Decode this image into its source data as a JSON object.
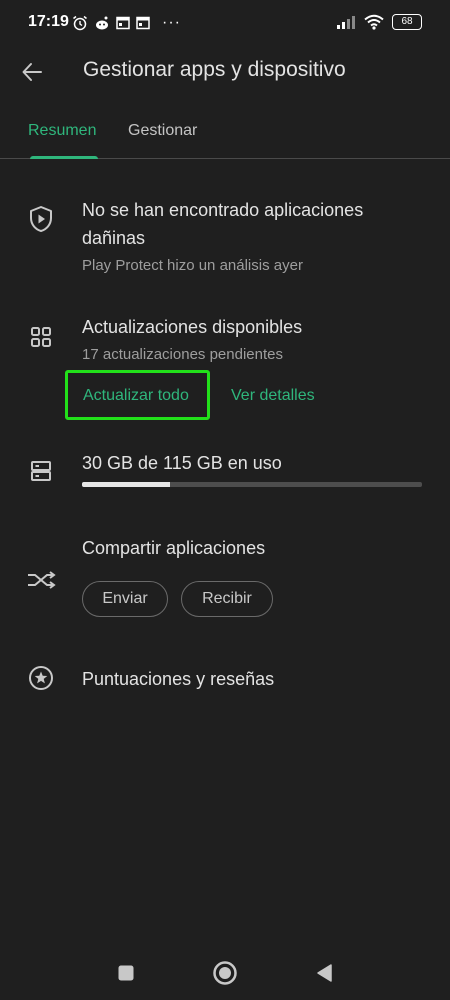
{
  "status_bar": {
    "time": "17:19",
    "battery": "68",
    "more_indicator": "···"
  },
  "header": {
    "title": "Gestionar apps y dispositivo"
  },
  "tabs": [
    {
      "label": "Resumen",
      "active": true
    },
    {
      "label": "Gestionar",
      "active": false
    }
  ],
  "play_protect": {
    "title": "No se han encontrado aplicaciones dañinas",
    "subtitle": "Play Protect hizo un análisis ayer"
  },
  "updates": {
    "title": "Actualizaciones disponibles",
    "subtitle": "17 actualizaciones pendientes",
    "update_all_label": "Actualizar todo",
    "details_label": "Ver detalles"
  },
  "storage": {
    "label": "30 GB de 115 GB en uso",
    "used_fraction": 0.26
  },
  "share": {
    "title": "Compartir aplicaciones",
    "send_label": "Enviar",
    "receive_label": "Recibir"
  },
  "ratings": {
    "title": "Puntuaciones y reseñas"
  },
  "colors": {
    "accent": "#2fb67c",
    "background": "#1f1f1f",
    "highlight": "#22e01a"
  }
}
